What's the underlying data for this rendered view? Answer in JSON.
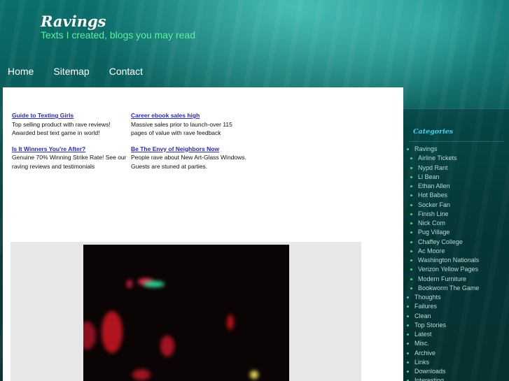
{
  "header": {
    "title": "Ravings",
    "tagline": "Texts I created, blogs you may read"
  },
  "nav": [
    {
      "label": "Home"
    },
    {
      "label": "Sitemap"
    },
    {
      "label": "Contact"
    }
  ],
  "ads": [
    {
      "title": "Guide to Texting Girls",
      "text": "Top selling product with rave reviews! Awarded best text game in world!"
    },
    {
      "title": "Career ebook sales high",
      "text": "Massive sales prior to launch-over 115 pages of value with rave feedback"
    },
    {
      "title": "Is It Winners You're After?",
      "text": "Genuine 70% Winning Strike Rate! See our raving reviews and testimonials"
    },
    {
      "title": "Be The Envy of Neighbors Now",
      "text": "People rave about New Art-Glass Windows. Guests are stuned at parties."
    }
  ],
  "sidebar": {
    "categories_title": "Categories",
    "items": [
      {
        "label": "Ravings",
        "level": 0
      },
      {
        "label": "Airline Tickets",
        "level": 1
      },
      {
        "label": "Nypd Rant",
        "level": 1
      },
      {
        "label": "Ll Bean",
        "level": 1
      },
      {
        "label": "Ethan Allen",
        "level": 1
      },
      {
        "label": "Hot Babes",
        "level": 1
      },
      {
        "label": "Socker Fan",
        "level": 1
      },
      {
        "label": "Finish Line",
        "level": 1
      },
      {
        "label": "Nick Com",
        "level": 1
      },
      {
        "label": "Pug Village",
        "level": 1
      },
      {
        "label": "Chaffey College",
        "level": 1
      },
      {
        "label": "Ac Moore",
        "level": 1
      },
      {
        "label": "Washington Nationals",
        "level": 1
      },
      {
        "label": "Verizon Yellow Pages",
        "level": 1
      },
      {
        "label": "Modern Furniture",
        "level": 1
      },
      {
        "label": "Bookworm The Game",
        "level": 1
      },
      {
        "label": "Thoughts",
        "level": 0
      },
      {
        "label": "Failures",
        "level": 0
      },
      {
        "label": "Clean",
        "level": 0
      },
      {
        "label": "Top Stories",
        "level": 0
      },
      {
        "label": "Latest",
        "level": 0
      },
      {
        "label": "Misc.",
        "level": 0
      },
      {
        "label": "Archive",
        "level": 0
      },
      {
        "label": "Links",
        "level": 0
      },
      {
        "label": "Downloads",
        "level": 0
      },
      {
        "label": "Interesting",
        "level": 0
      }
    ]
  }
}
